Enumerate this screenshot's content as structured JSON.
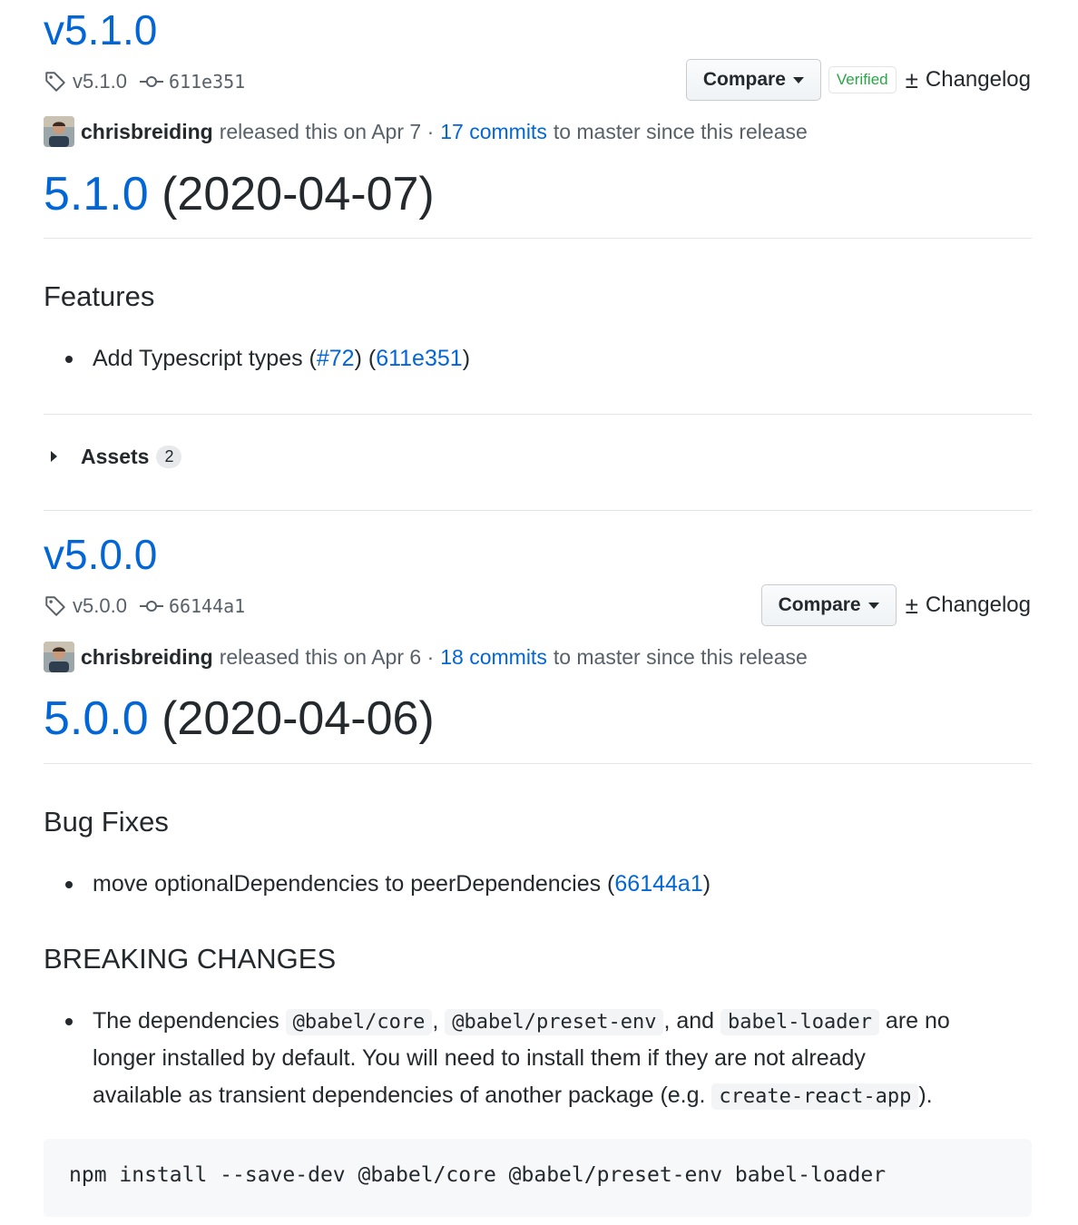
{
  "releases": [
    {
      "title": "v5.1.0",
      "tag": "v5.1.0",
      "commit": "611e351",
      "compare_label": "Compare",
      "verified_label": "Verified",
      "changelog_label": "Changelog",
      "author": "chrisbreiding",
      "released_text": "released this on Apr 7 ·",
      "commits_link": "17 commits",
      "since_text": "to master since this release",
      "heading_version": "5.1.0",
      "heading_date": "(2020-04-07)",
      "section_title": "Features",
      "item_prefix": "Add Typescript types (",
      "item_link1": "#72",
      "item_mid": ") (",
      "item_link2": "611e351",
      "item_suffix": ")",
      "assets_label": "Assets",
      "assets_count": "2"
    },
    {
      "title": "v5.0.0",
      "tag": "v5.0.0",
      "commit": "66144a1",
      "compare_label": "Compare",
      "changelog_label": "Changelog",
      "author": "chrisbreiding",
      "released_text": "released this on Apr 6 ·",
      "commits_link": "18 commits",
      "since_text": "to master since this release",
      "heading_version": "5.0.0",
      "heading_date": "(2020-04-06)",
      "section_title": "Bug Fixes",
      "item_prefix": "move optionalDependencies to peerDependencies (",
      "item_link": "66144a1",
      "item_suffix": ")",
      "breaking_title": "BREAKING CHANGES",
      "breaking": {
        "t1": "The dependencies",
        "c1": "@babel/core",
        "t2": ",",
        "c2": "@babel/preset-env",
        "t3": ", and",
        "c3": "babel-loader",
        "t4": "are no",
        "line2": "longer installed by default. You will need to install them if they are not already",
        "line3": "available as transient dependencies of another package (e.g.",
        "c4": "create-react-app",
        "t5": ")."
      },
      "code": "npm install --save-dev @babel/core @babel/preset-env babel-loader"
    }
  ]
}
